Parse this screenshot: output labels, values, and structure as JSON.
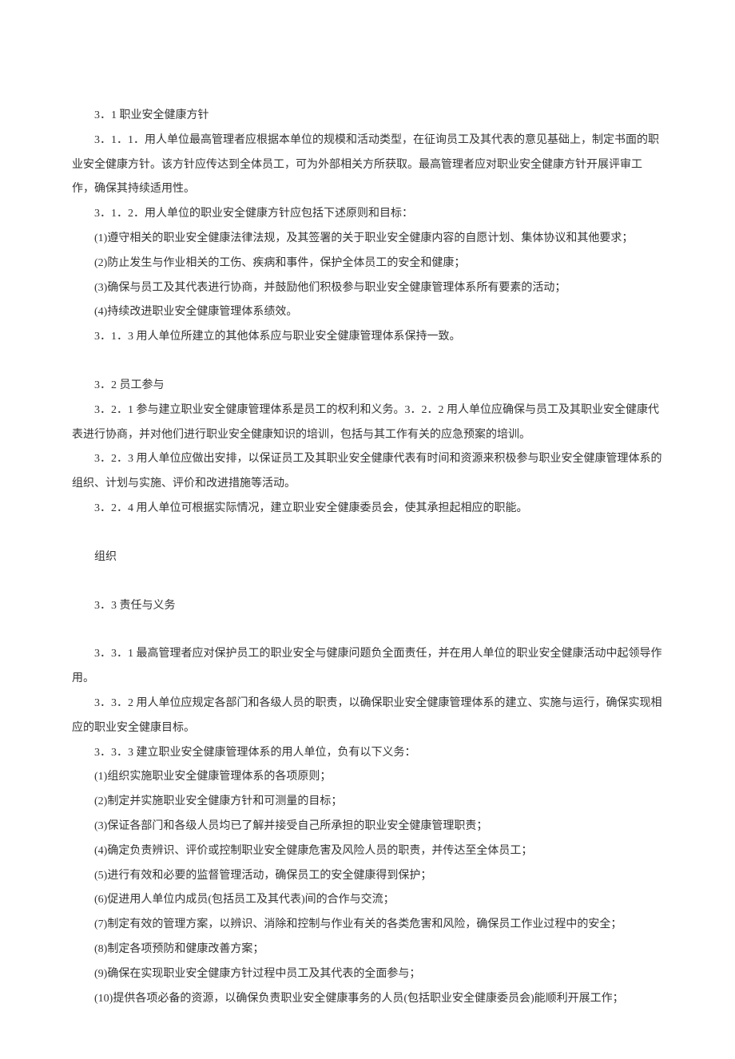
{
  "lines": [
    "3．1 职业安全健康方针",
    "3．1．1．用人单位最高管理者应根据本单位的规模和活动类型，在征询员工及其代表的意见基础上，制定书面的职业安全健康方针。该方针应传达到全体员工，可为外部相关方所获取。最高管理者应对职业安全健康方针开展评审工作，确保其持续适用性。",
    "3．1．2．用人单位的职业安全健康方针应包括下述原则和目标：",
    "(1)遵守相关的职业安全健康法律法规，及其签署的关于职业安全健康内容的自愿计划、集体协议和其他要求；",
    "(2)防止发生与作业相关的工伤、疾病和事件，保护全体员工的安全和健康；",
    "(3)确保与员工及其代表进行协商，并鼓励他们积极参与职业安全健康管理体系所有要素的活动；",
    "(4)持续改进职业安全健康管理体系绩效。",
    "3．1．3 用人单位所建立的其他体系应与职业安全健康管理体系保持一致。",
    "__SPACER__",
    "3．2 员工参与",
    "3．2．1 参与建立职业安全健康管理体系是员工的权利和义务。3．2．2 用人单位应确保与员工及其职业安全健康代表进行协商，并对他们进行职业安全健康知识的培训，包括与其工作有关的应急预案的培训。",
    "3．2．3 用人单位应做出安排，以保证员工及其职业安全健康代表有时间和资源来积极参与职业安全健康管理体系的组织、计划与实施、评价和改进措施等活动。",
    "3．2．4 用人单位可根据实际情况，建立职业安全健康委员会，使其承担起相应的职能。",
    "__SPACER__",
    "组织",
    "__SPACER__",
    "3．3 责任与义务",
    "__SPACER__",
    "3．3．1 最高管理者应对保护员工的职业安全与健康问题负全面责任，并在用人单位的职业安全健康活动中起领导作用。",
    "3．3．2 用人单位应规定各部门和各级人员的职责，以确保职业安全健康管理体系的建立、实施与运行，确保实现相应的职业安全健康目标。",
    "3．3．3 建立职业安全健康管理体系的用人单位，负有以下义务：",
    "(1)组织实施职业安全健康管理体系的各项原则；",
    "(2)制定并实施职业安全健康方针和可测量的目标；",
    "(3)保证各部门和各级人员均已了解并接受自己所承担的职业安全健康管理职责；",
    "(4)确定负责辨识、评价或控制职业安全健康危害及风险人员的职责，并传达至全体员工；",
    "(5)进行有效和必要的监督管理活动，确保员工的安全健康得到保护；",
    "(6)促进用人单位内成员(包括员工及其代表)间的合作与交流；",
    "(7)制定有效的管理方案，以辨识、消除和控制与作业有关的各类危害和风险，确保员工作业过程中的安全；",
    "(8)制定各项预防和健康改善方案；",
    "(9)确保在实现职业安全健康方针过程中员工及其代表的全面参与；",
    "(10)提供各项必备的资源，以确保负责职业安全健康事务的人员(包括职业安全健康委员会)能顺利开展工作；"
  ]
}
